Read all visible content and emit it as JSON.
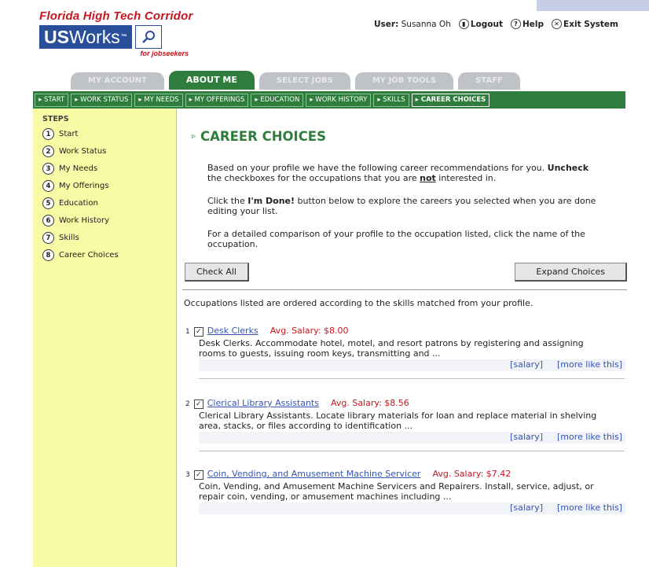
{
  "brand": {
    "title": "Florida High Tech Corridor",
    "logo_text_bold": "US",
    "logo_text_light": "Works",
    "logo_tm": "™",
    "logo_subtitle": "for jobseekers"
  },
  "user_bar": {
    "user_label": "User:",
    "user_name": "Susanna Oh",
    "logout": "Logout",
    "help": "Help",
    "exit": "Exit System"
  },
  "tabs": [
    {
      "label": "MY ACCOUNT"
    },
    {
      "label": "ABOUT ME"
    },
    {
      "label": "SELECT JOBS"
    },
    {
      "label": "MY JOB TOOLS"
    },
    {
      "label": "STAFF"
    }
  ],
  "subnav": [
    {
      "label": "▸ START"
    },
    {
      "label": "▸ WORK STATUS"
    },
    {
      "label": "▸ MY NEEDS"
    },
    {
      "label": "▸ MY OFFERINGS"
    },
    {
      "label": "▸ EDUCATION"
    },
    {
      "label": "▸ WORK HISTORY"
    },
    {
      "label": "▸ SKILLS"
    },
    {
      "label": "▸ CAREER CHOICES"
    }
  ],
  "sidebar": {
    "title": "STEPS",
    "steps": [
      {
        "num": "1",
        "label": "Start"
      },
      {
        "num": "2",
        "label": "Work Status"
      },
      {
        "num": "3",
        "label": "My Needs"
      },
      {
        "num": "4",
        "label": "My Offerings"
      },
      {
        "num": "5",
        "label": "Education"
      },
      {
        "num": "6",
        "label": "Work History"
      },
      {
        "num": "7",
        "label": "Skills"
      },
      {
        "num": "8",
        "label": "Career Choices"
      }
    ]
  },
  "main": {
    "title": "CAREER CHOICES",
    "para1_a": "Based on your profile we have the following career recommendations for you. ",
    "para1_b": "Uncheck",
    "para1_c": " the checkboxes for the occupations that you are ",
    "para1_d": "not",
    "para1_e": " interested in.",
    "para2_a": "Click the ",
    "para2_b": "I'm Done!",
    "para2_c": " button below to explore the careers you selected when you are done editing your list.",
    "para3": "For a detailed comparison of your profile to the occupation listed, click the name of the occupation.",
    "check_all": "Check All",
    "expand_choices": "Expand Choices",
    "note": "Occupations listed are ordered according to the skills matched from your profile.",
    "salary_link": "[salary]",
    "more_link": "[more like this]",
    "occupations": [
      {
        "num": "1",
        "name": "Desk Clerks",
        "salary": "Avg. Salary: $8.00",
        "desc": "Desk Clerks. Accommodate hotel, motel, and resort patrons by registering and assigning rooms to guests, issuing room keys, transmitting and ..."
      },
      {
        "num": "2",
        "name": "Clerical Library Assistants",
        "salary": "Avg. Salary: $8.56",
        "desc": "Clerical Library Assistants. Locate library materials for loan and replace material in shelving area, stacks, or files according to identification ..."
      },
      {
        "num": "3",
        "name": "Coin, Vending, and Amusement Machine Servicer",
        "salary": "Avg. Salary: $7.42",
        "desc": "Coin, Vending, and Amusement Machine Servicers and Repairers. Install, service, adjust, or repair coin, vending, or amusement machines including ..."
      }
    ]
  }
}
